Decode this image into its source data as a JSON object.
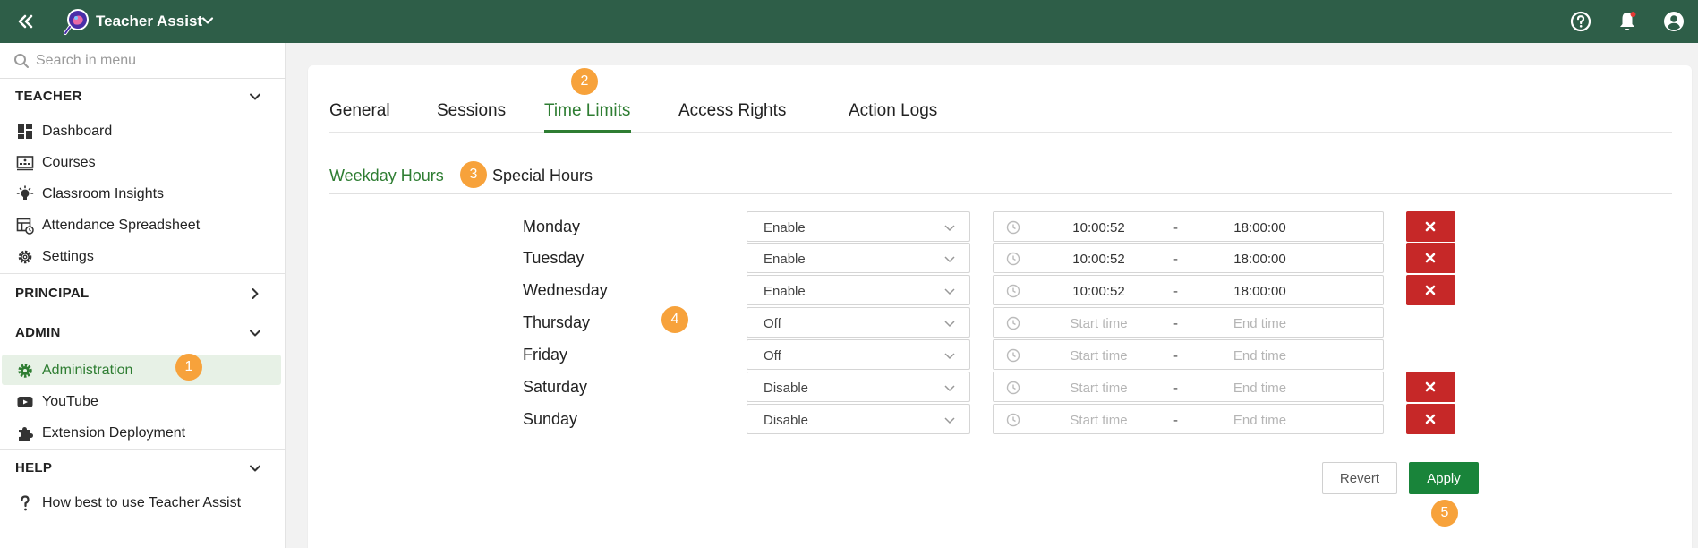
{
  "header": {
    "app_title": "Teacher Assist",
    "icons": [
      "double-chevron-left-icon",
      "app-logo",
      "chevron-down-icon",
      "help-icon",
      "notification-bell-icon",
      "account-icon"
    ],
    "colors": {
      "bar": "#2e5e48",
      "notification_dot": "#e53935"
    }
  },
  "sidebar": {
    "search_placeholder": "Search in menu",
    "sections": {
      "teacher": {
        "label": "TEACHER",
        "items": [
          "Dashboard",
          "Courses",
          "Classroom Insights",
          "Attendance Spreadsheet",
          "Settings"
        ]
      },
      "principal": {
        "label": "PRINCIPAL"
      },
      "admin": {
        "label": "ADMIN",
        "items": [
          "Administration",
          "YouTube",
          "Extension Deployment"
        ],
        "active_item": "Administration"
      },
      "help": {
        "label": "HELP",
        "items": [
          "How best to use Teacher Assist"
        ]
      }
    }
  },
  "tabs": [
    "General",
    "Sessions",
    "Time Limits",
    "Access Rights",
    "Action Logs"
  ],
  "active_tab": "Time Limits",
  "subtabs": [
    "Weekday Hours",
    "Special Hours"
  ],
  "active_subtab": "Weekday Hours",
  "schedule": [
    {
      "day": "Monday",
      "mode": "Enable",
      "start": "10:00:52",
      "end": "18:00:00",
      "deletable": true
    },
    {
      "day": "Tuesday",
      "mode": "Enable",
      "start": "10:00:52",
      "end": "18:00:00",
      "deletable": true
    },
    {
      "day": "Wednesday",
      "mode": "Enable",
      "start": "10:00:52",
      "end": "18:00:00",
      "deletable": true
    },
    {
      "day": "Thursday",
      "mode": "Off",
      "start_placeholder": "Start time",
      "end_placeholder": "End time",
      "deletable": false
    },
    {
      "day": "Friday",
      "mode": "Off",
      "start_placeholder": "Start time",
      "end_placeholder": "End time",
      "deletable": false
    },
    {
      "day": "Saturday",
      "mode": "Disable",
      "start_placeholder": "Start time",
      "end_placeholder": "End time",
      "deletable": true
    },
    {
      "day": "Sunday",
      "mode": "Disable",
      "start_placeholder": "Start time",
      "end_placeholder": "End time",
      "deletable": true
    }
  ],
  "time_separator": "-",
  "actions": {
    "revert": "Revert",
    "apply": "Apply"
  },
  "step_badges": [
    "1",
    "2",
    "3",
    "4",
    "5"
  ],
  "colors": {
    "accent": "#2e7d32",
    "delete": "#c62828",
    "apply": "#19843a",
    "badge": "#f7a23b"
  }
}
